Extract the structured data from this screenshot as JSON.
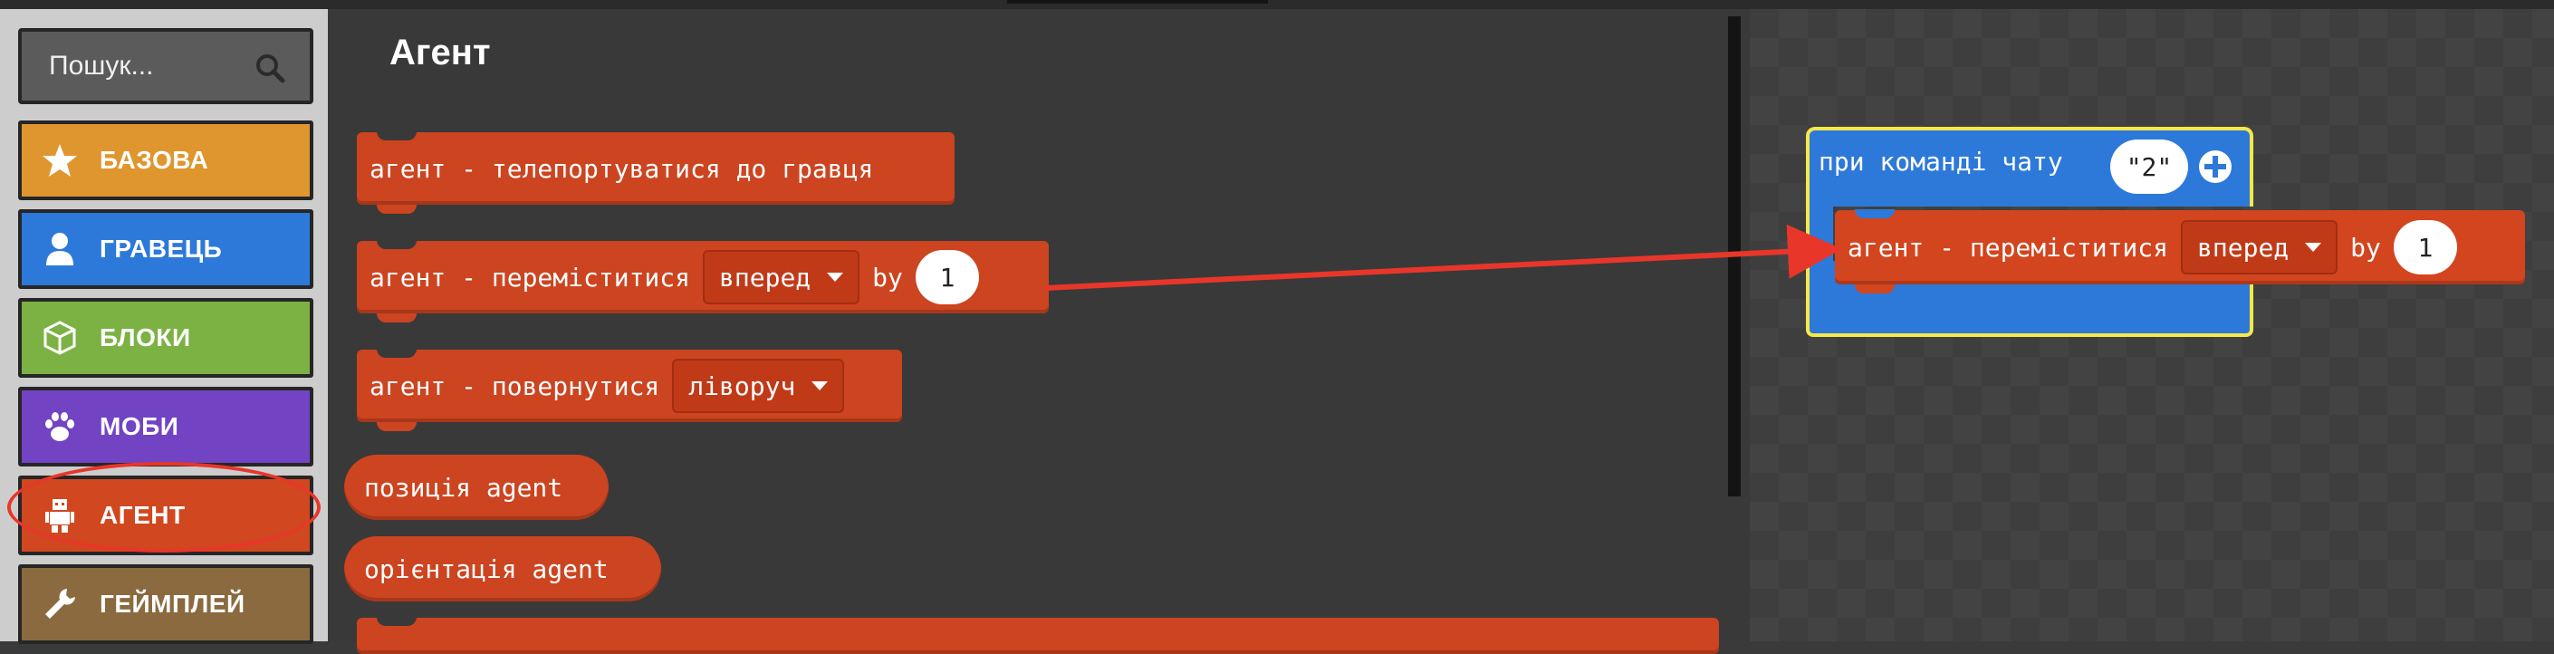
{
  "search": {
    "placeholder": "Пошук..."
  },
  "categories": [
    {
      "label": "БАЗОВА",
      "icon": "star-icon",
      "color": "#e0962e"
    },
    {
      "label": "ГРАВЕЦЬ",
      "icon": "person-icon",
      "color": "#2d79d9"
    },
    {
      "label": "БЛОКИ",
      "icon": "cube-icon",
      "color": "#7cb244"
    },
    {
      "label": "МОБИ",
      "icon": "paw-icon",
      "color": "#7244c4"
    },
    {
      "label": "АГЕНТ",
      "icon": "robot-icon",
      "color": "#d04720"
    },
    {
      "label": "ГЕЙМПЛЕЙ",
      "icon": "wrench-icon",
      "color": "#8a6a3e"
    }
  ],
  "flyout": {
    "title": "Агент",
    "blocks": {
      "teleport": "агент - телепортуватися до гравця",
      "move": {
        "text": "агент - переміститися",
        "direction": "вперед",
        "by": "by",
        "amount": "1"
      },
      "turn": {
        "text": "агент - повернутися",
        "direction": "ліворуч"
      },
      "position": "позиція agent",
      "orientation": "орієнтація agent"
    }
  },
  "workspace": {
    "event": {
      "label": "при команді чату",
      "arg": "\"2\""
    },
    "move": {
      "text": "агент - переміститися",
      "direction": "вперед",
      "by": "by",
      "amount": "1"
    }
  },
  "colors": {
    "agent": "#cc4420",
    "event": "#2d79d9",
    "highlight": "#e8362a",
    "selection": "#f7e84a"
  }
}
